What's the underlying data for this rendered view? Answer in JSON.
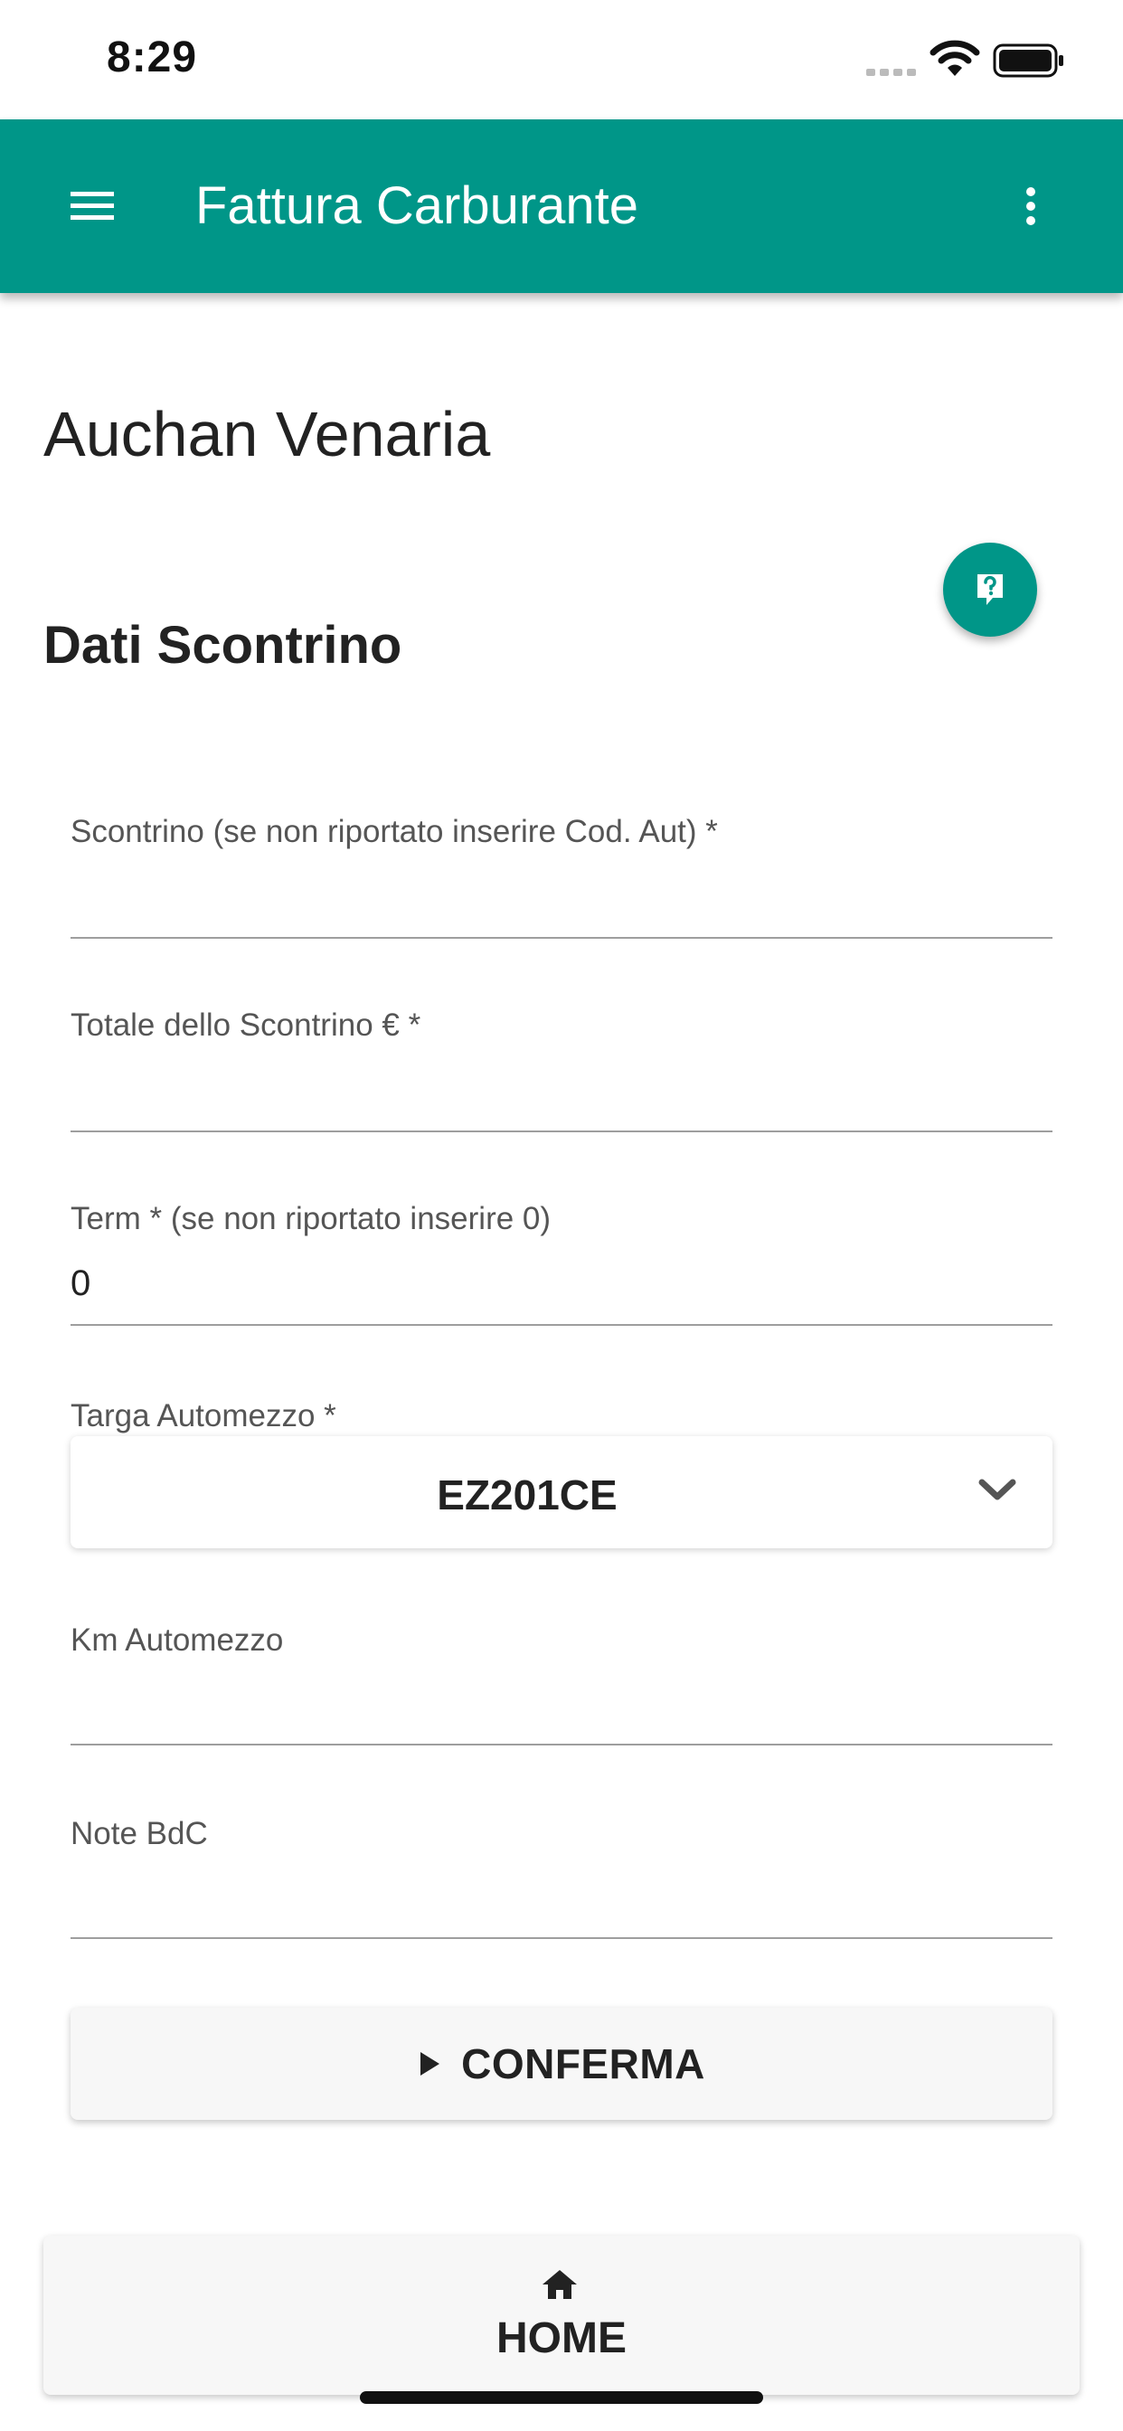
{
  "status_bar": {
    "time": "8:29"
  },
  "app_bar": {
    "title": "Fattura Carburante",
    "menu_icon": "hamburger-menu-icon",
    "more_icon": "vertical-dots-icon"
  },
  "station": {
    "name": "Auchan Venaria"
  },
  "help_fab": {
    "icon": "help-icon",
    "color": "#009688"
  },
  "section": {
    "title": "Dati Scontrino"
  },
  "form": {
    "receipt": {
      "label": "Scontrino (se non riportato inserire Cod. Aut) *",
      "value": ""
    },
    "total": {
      "label": "Totale dello Scontrino € *",
      "value": ""
    },
    "term": {
      "label": "Term * (se non riportato inserire 0)",
      "value": "0"
    },
    "plate": {
      "label": "Targa Automezzo *",
      "selected": "EZ201CE"
    },
    "km": {
      "label": "Km Automezzo",
      "value": ""
    },
    "notes": {
      "label": "Note BdC",
      "value": ""
    }
  },
  "actions": {
    "confirm_label": "CONFERMA",
    "home_label": "HOME"
  },
  "colors": {
    "accent": "#009688",
    "text": "#222222",
    "label": "#555555"
  }
}
